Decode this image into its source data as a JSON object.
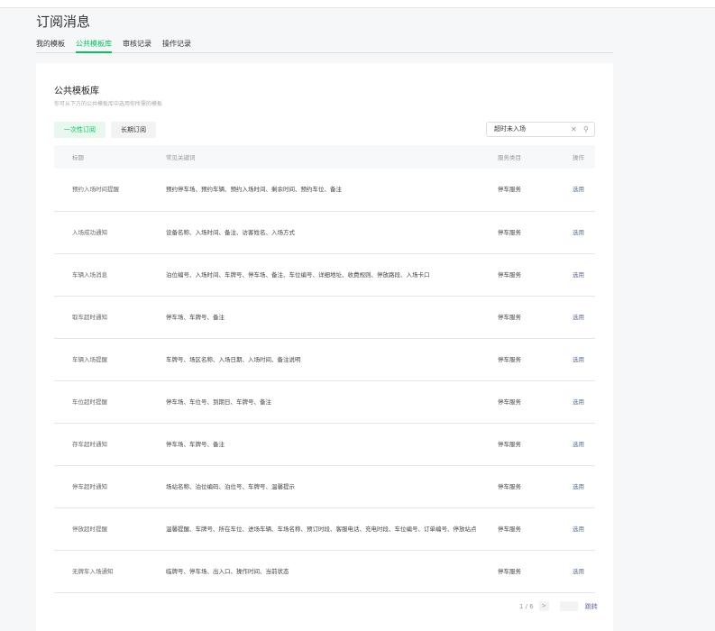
{
  "header": {
    "title": "订阅消息"
  },
  "tabs": [
    {
      "label": "我的模板"
    },
    {
      "label": "公共模板库"
    },
    {
      "label": "审核记录"
    },
    {
      "label": "操作记录"
    }
  ],
  "card": {
    "title": "公共模板库",
    "description": "你可从下方的公共模板库中选用你所需的模板",
    "btn_once": "一次性订阅",
    "btn_long": "长期订阅",
    "search_value": "超时未入场"
  },
  "table": {
    "headers": [
      "标题",
      "常见关键词",
      "服务类目",
      "操作"
    ],
    "rows": [
      {
        "title": "预约入场时间提醒",
        "keywords": "预约停车场、预约车辆、预约入场时间、剩余时间、预约车位、备注",
        "category": "停车服务",
        "action": "选用"
      },
      {
        "title": "入场成功通知",
        "keywords": "设备名称、入场时间、备注、访客姓名、入场方式",
        "category": "停车服务",
        "action": "选用"
      },
      {
        "title": "车辆入场消息",
        "keywords": "泊位编号、入场时间、车牌号、停车场、备注、车位编号、详细地址、收费规则、停放路段、入场卡口",
        "category": "停车服务",
        "action": "选用"
      },
      {
        "title": "取车超时通知",
        "keywords": "停车场、车牌号、备注",
        "category": "停车服务",
        "action": "选用"
      },
      {
        "title": "车辆入场提醒",
        "keywords": "车牌号、场区名称、入场日期、入场时间、备注说明",
        "category": "停车服务",
        "action": "选用"
      },
      {
        "title": "车位超时提醒",
        "keywords": "停车场、车位号、到期日、车牌号、备注",
        "category": "停车服务",
        "action": "选用"
      },
      {
        "title": "存车超时通知",
        "keywords": "停车场、车牌号、备注",
        "category": "停车服务",
        "action": "选用"
      },
      {
        "title": "停车超时通知",
        "keywords": "场站名称、泊位编码、泊位号、车牌号、温馨提示",
        "category": "停车服务",
        "action": "选用"
      },
      {
        "title": "停放超时提醒",
        "keywords": "温馨提醒、车牌号、所在车位、进场车辆、车场名称、预订时段、客服电话、充电时段、车位编号、订单编号、停放站点",
        "category": "停车服务",
        "action": "选用"
      },
      {
        "title": "无牌车入场通知",
        "keywords": "临牌号、停车场、出入口、操作时间、当前状态",
        "category": "停车服务",
        "action": "选用"
      }
    ]
  },
  "pager": {
    "text": "1 / 6",
    "next": ">",
    "go": "跳转"
  }
}
